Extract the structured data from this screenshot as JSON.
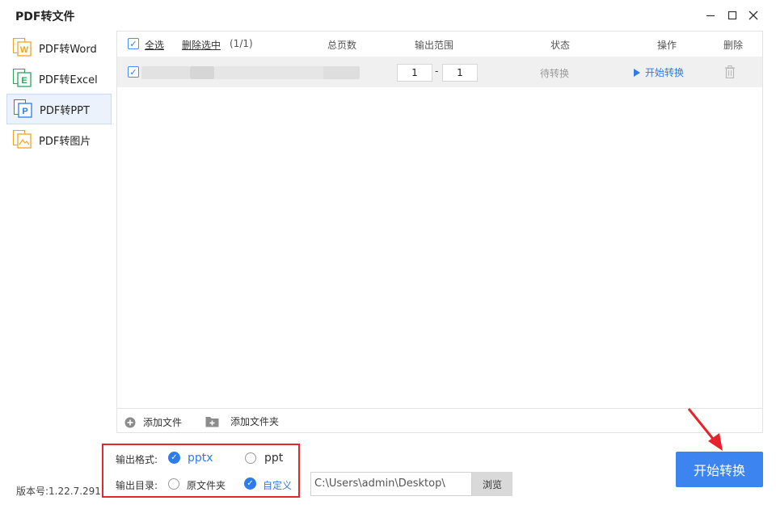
{
  "window": {
    "title": "PDF转文件",
    "controls": [
      "minimize-icon",
      "maximize-icon",
      "close-icon"
    ]
  },
  "sidebar": {
    "items": [
      {
        "label": "PDF转Word",
        "badge": "W",
        "color": "#f0a320",
        "active": false
      },
      {
        "label": "PDF转Excel",
        "badge": "E",
        "color": "#27a85a",
        "active": false
      },
      {
        "label": "PDF转PPT",
        "badge": "P",
        "color": "#2f7be8",
        "active": true
      },
      {
        "label": "PDF转图片",
        "badge": "",
        "color": "#f0a320",
        "active": false
      }
    ]
  },
  "table": {
    "select_all": "全选",
    "delete_selected": "删除选中",
    "count": "(1/1)",
    "headers": {
      "pages": "总页数",
      "range": "输出范围",
      "status": "状态",
      "action": "操作",
      "delete": "删除"
    },
    "rows": [
      {
        "checked": true,
        "range_from": "1",
        "range_sep": "-",
        "range_to": "1",
        "status": "待转换",
        "action": "开始转换"
      }
    ]
  },
  "footer": {
    "add_file": "添加文件",
    "add_folder": "添加文件夹"
  },
  "options": {
    "format_label": "输出格式:",
    "formats": [
      {
        "label": "pptx",
        "selected": true
      },
      {
        "label": "ppt",
        "selected": false
      }
    ],
    "dir_label": "输出目录:",
    "dirs": [
      {
        "label": "原文件夹",
        "selected": false
      },
      {
        "label": "自定义",
        "selected": true
      }
    ],
    "path": "C:\\Users\\admin\\Desktop\\",
    "browse": "浏览"
  },
  "version": "版本号:1.22.7.291",
  "start_button": "开始转换",
  "colors": {
    "accent": "#2f7be8",
    "highlight_box": "#e0282d",
    "arrow": "#e8222a"
  }
}
